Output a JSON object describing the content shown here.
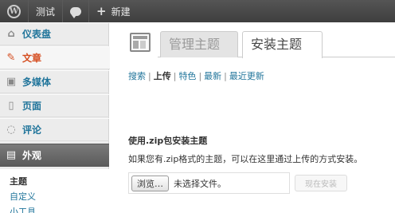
{
  "adminbar": {
    "site_name": "测试",
    "new_label": "新建"
  },
  "sidebar": {
    "items": [
      {
        "label": "仪表盘",
        "icon": "dashboard-icon"
      },
      {
        "label": "文章",
        "icon": "pin-icon"
      },
      {
        "label": "多媒体",
        "icon": "media-icon"
      },
      {
        "label": "页面",
        "icon": "pages-icon"
      },
      {
        "label": "评论",
        "icon": "comments-icon"
      },
      {
        "label": "外观",
        "icon": "appearance-icon"
      }
    ],
    "submenu": [
      "主题",
      "自定义",
      "小工具"
    ]
  },
  "main": {
    "tabs": [
      "管理主题",
      "安装主题"
    ],
    "filters": [
      "搜索",
      "上传",
      "特色",
      "最新",
      "最近更新"
    ],
    "current_filter": "上传",
    "section_title": "使用.zip包安装主题",
    "section_desc": "如果您有.zip格式的主题，可以在这里通过上传的方式安装。",
    "browse_label": "浏览…",
    "no_file_label": "未选择文件。",
    "install_label": "现在安装"
  }
}
